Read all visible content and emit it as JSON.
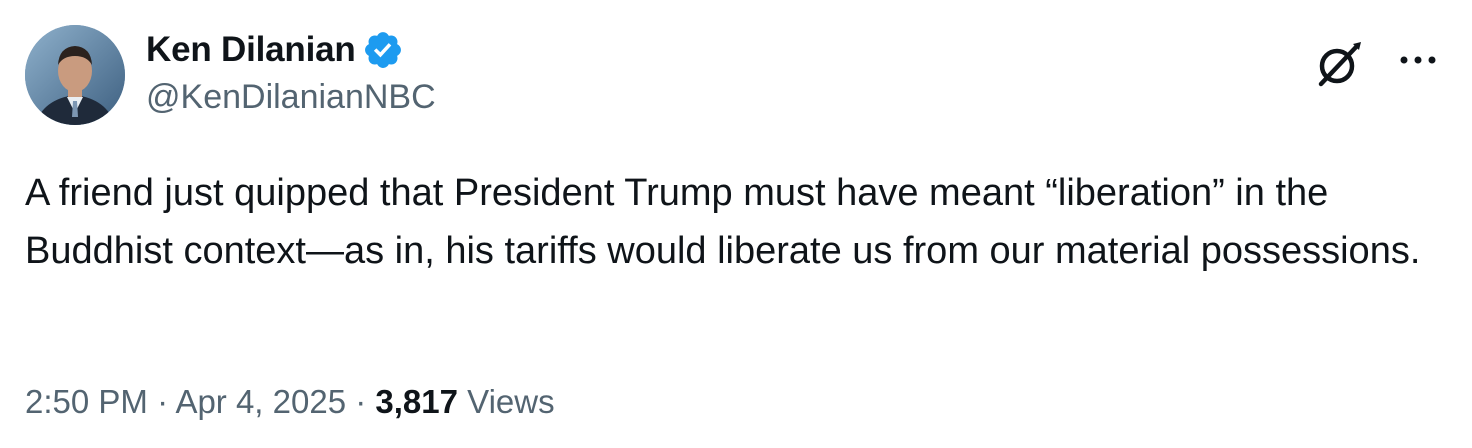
{
  "author": {
    "name": "Ken Dilanian",
    "handle": "@KenDilanianNBC",
    "verified": true
  },
  "tweet": {
    "text": "A friend just quipped that President Trump must have meant “liberation” in the Buddhist context—as in, his tariffs would liberate us from our material possessions."
  },
  "meta": {
    "time": "2:50 PM",
    "separator": "·",
    "date": "Apr 4, 2025",
    "views_count": "3,817",
    "views_label": "Views"
  },
  "icons": {
    "verified": "verified-badge-icon",
    "grok": "grok-icon",
    "more": "more-options-icon"
  },
  "colors": {
    "verified_blue": "#1d9bf0",
    "text_primary": "#0f1419",
    "text_secondary": "#536471"
  }
}
